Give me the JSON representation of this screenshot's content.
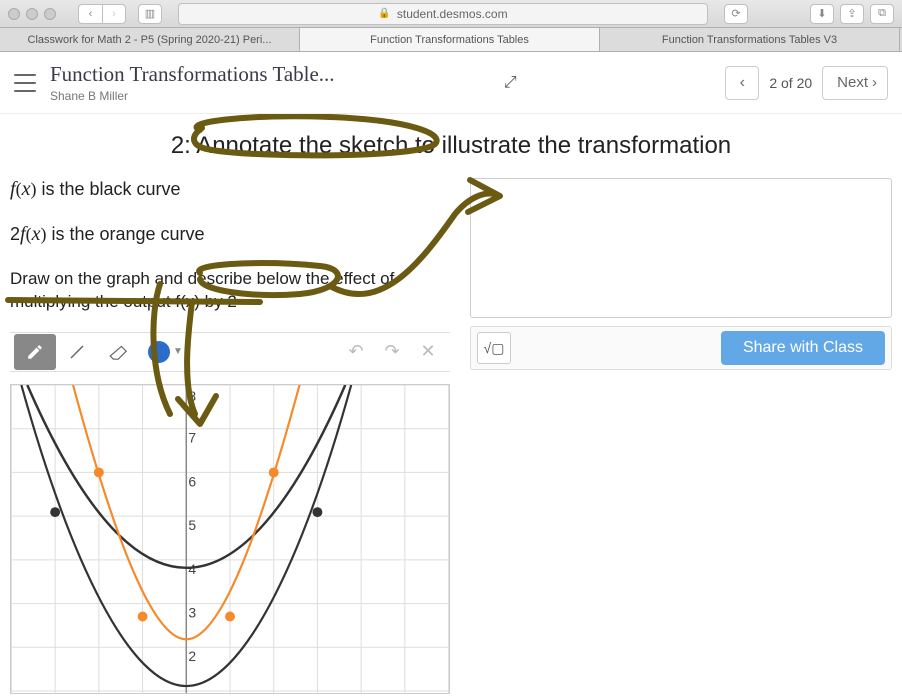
{
  "browser": {
    "url": "student.desmos.com",
    "tabs": [
      "Classwork for Math 2 - P5 (Spring 2020-21) Peri...",
      "Function Transformations Tables",
      "Function Transformations Tables V3"
    ]
  },
  "header": {
    "title": "Function Transformations Table...",
    "author": "Shane B Miller",
    "pager": "2 of 20",
    "next": "Next"
  },
  "slide": {
    "title": "2: Annotate the sketch to illustrate the transformation",
    "line1_fn": "f(x)",
    "line1_rest": " is the black curve",
    "line2_fn": "2f(x)",
    "line2_rest": " is the orange curve",
    "prompt": "Draw on the graph and describe below the effect of multiplying the output f(x) by 2"
  },
  "actions": {
    "sqrt": "√▢",
    "share": "Share with Class"
  },
  "chart_data": {
    "type": "line",
    "xlim": [
      -4,
      4
    ],
    "ylim": [
      1,
      8
    ],
    "grid": true,
    "series": [
      {
        "name": "f(x)",
        "color": "#333333",
        "points": [
          [
            -3,
            5.1
          ],
          [
            -2,
            3
          ],
          [
            -1,
            1.55
          ],
          [
            0,
            1.1
          ],
          [
            1,
            1.55
          ],
          [
            2,
            3
          ],
          [
            3,
            5.1
          ]
        ],
        "marked_points": [
          [
            -3,
            5.1
          ],
          [
            3,
            5.1
          ]
        ]
      },
      {
        "name": "2f(x)",
        "color": "#f58a2a",
        "points": [
          [
            -2.6,
            8
          ],
          [
            -2,
            6
          ],
          [
            -1,
            3.1
          ],
          [
            0,
            2.2
          ],
          [
            1,
            3.1
          ],
          [
            2,
            6
          ],
          [
            2.6,
            8
          ]
        ],
        "marked_points": [
          [
            -2,
            6
          ],
          [
            -1,
            2.7
          ],
          [
            1,
            2.7
          ],
          [
            2,
            6
          ]
        ]
      }
    ],
    "y_ticks": [
      2,
      3,
      4,
      5,
      6,
      7,
      8
    ]
  }
}
